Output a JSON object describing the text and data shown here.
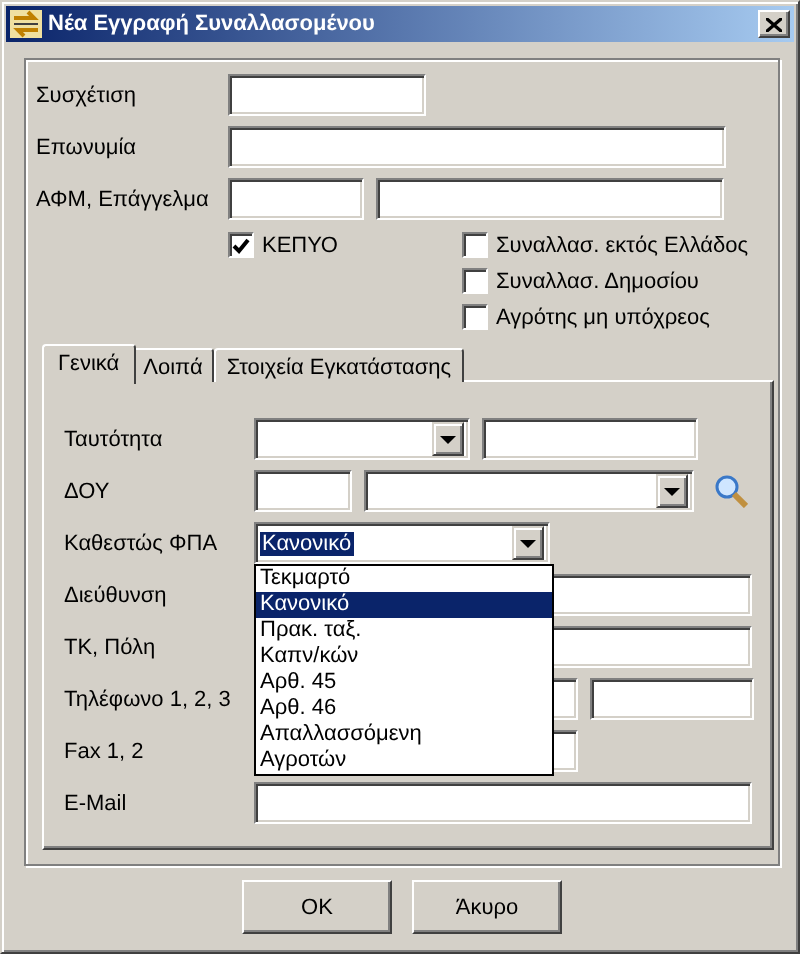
{
  "window": {
    "title": "Νέα Εγγραφή Συναλλασομένου"
  },
  "top_fields": [
    {
      "label": "Συσχέτιση",
      "inputs": [
        {
          "kind": "text"
        }
      ]
    },
    {
      "label": "Επωνυμία",
      "inputs": [
        {
          "kind": "text"
        }
      ]
    },
    {
      "label": "ΑΦΜ, Επάγγελμα",
      "inputs": [
        {
          "kind": "text"
        },
        {
          "kind": "text"
        }
      ]
    }
  ],
  "checkboxes": [
    {
      "label": "ΚΕΠΥΟ",
      "checked": true
    },
    {
      "label": "Συναλλασ. εκτός Ελλάδος",
      "checked": false
    },
    {
      "label": "Συναλλασ. Δημοσίου",
      "checked": false
    },
    {
      "label": "Αγρότης μη υπόχρεος",
      "checked": false
    }
  ],
  "tabs": [
    {
      "label": "Γενικά",
      "selected": true
    },
    {
      "label": "Λοιπά",
      "selected": false
    },
    {
      "label": "Στοιχεία Εγκατάστασης",
      "selected": false
    }
  ],
  "tab_fields": [
    {
      "label": "Ταυτότητα",
      "inputs": [
        {
          "kind": "combo"
        },
        {
          "kind": "text"
        }
      ]
    },
    {
      "label": "ΔΟΥ",
      "inputs": [
        {
          "kind": "text"
        },
        {
          "kind": "combo"
        },
        {
          "kind": "search"
        }
      ]
    },
    {
      "label": "Καθεστώς ΦΠΑ",
      "inputs": [
        {
          "kind": "combo",
          "value": "Κανονικό",
          "focused": true,
          "open": true,
          "options": [
            {
              "label": "Τεκμαρτό",
              "selected": false
            },
            {
              "label": "Κανονικό",
              "selected": true
            },
            {
              "label": "Πρακ. ταξ.",
              "selected": false
            },
            {
              "label": "Καπν/κών",
              "selected": false
            },
            {
              "label": "Αρθ. 45",
              "selected": false
            },
            {
              "label": "Αρθ. 46",
              "selected": false
            },
            {
              "label": "Απαλλασσόμενη",
              "selected": false
            },
            {
              "label": "Αγροτών",
              "selected": false
            }
          ]
        }
      ]
    },
    {
      "label": "Διεύθυνση",
      "inputs": [
        {
          "kind": "text"
        }
      ]
    },
    {
      "label": "ΤΚ, Πόλη",
      "inputs": [
        {
          "kind": "text"
        }
      ]
    },
    {
      "label": "Τηλέφωνο 1, 2, 3",
      "inputs": [
        {
          "kind": "text"
        },
        {
          "kind": "text"
        }
      ]
    },
    {
      "label": "Fax 1, 2",
      "inputs": [
        {
          "kind": "text"
        }
      ]
    },
    {
      "label": "E-Mail",
      "inputs": [
        {
          "kind": "text"
        }
      ]
    }
  ],
  "buttons": [
    "OK",
    "Άκυρο"
  ]
}
